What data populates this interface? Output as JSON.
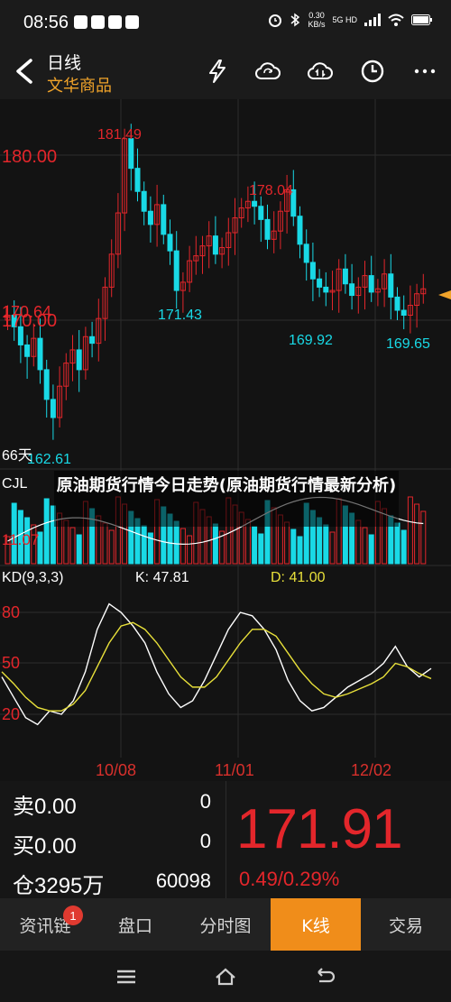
{
  "status_bar": {
    "time": "08:56",
    "speed_value": "0.30",
    "speed_unit": "KB/s",
    "network": "5G HD"
  },
  "header": {
    "title": "日线",
    "subtitle": "文华商品"
  },
  "main_chart": {
    "price_axis": [
      "180.00",
      "170.64",
      "170.00"
    ],
    "annotations": {
      "high": "181.49",
      "peak2": "178.04",
      "low1": "171.43",
      "low2": "169.92",
      "low3": "169.65",
      "bottom": "162.61",
      "left_label": "66天"
    }
  },
  "volume_panel": {
    "label": "CJL",
    "value": "11.07"
  },
  "overlay_title": "原油期货行情今日走势(原油期货行情最新分析)",
  "kd_panel": {
    "label": "KD(9,3,3)",
    "k_text": "K: 47.81",
    "d_text": "D: 41.00",
    "levels": [
      "80",
      "50",
      "20"
    ]
  },
  "x_axis": [
    "10/08",
    "11/01",
    "12/02"
  ],
  "quote": {
    "sell_label": "卖",
    "sell_price": "0.00",
    "sell_qty": "0",
    "buy_label": "买",
    "buy_price": "0.00",
    "buy_qty": "0",
    "position_label": "仓",
    "position_value": "3295万",
    "position_change": "60098",
    "last_price": "171.91",
    "change": "0.49/0.29%"
  },
  "tabs": [
    {
      "label": "资讯链"
    },
    {
      "label": "盘口"
    },
    {
      "label": "分时图"
    },
    {
      "label": "K线"
    },
    {
      "label": "交易"
    }
  ],
  "badge_count": "1",
  "colors": {
    "up": "#e3262b",
    "down": "#19d9e6",
    "accent": "#f08d1a",
    "k_line": "#ffffff",
    "d_line": "#e8e03a"
  }
}
